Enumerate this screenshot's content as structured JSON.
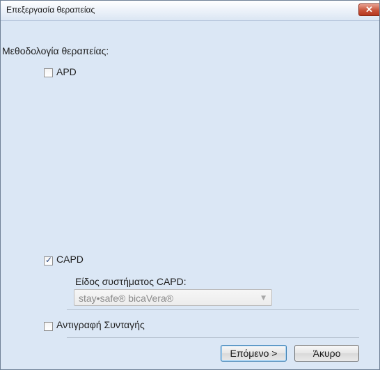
{
  "window": {
    "title": "Επεξεργασία θεραπείας",
    "close_icon": "close-icon",
    "close_glyph": "✕"
  },
  "form": {
    "methodology_label": "Μεθοδολογία θεραπείας:",
    "apd": {
      "label": "APD",
      "checked": false
    },
    "capd": {
      "label": "CAPD",
      "checked": true
    },
    "system_type_label": "Είδος συστήματος CAPD:",
    "system_type_value": "stay•safe® bicaVera®",
    "system_type_enabled": false,
    "copy_prescription": {
      "label": "Αντιγραφή Συνταγής",
      "checked": false
    }
  },
  "buttons": {
    "next": "Επόμενο >",
    "cancel": "Άκυρο"
  },
  "colors": {
    "dialog_background": "#dbe7f5",
    "close_button": "#c8533a"
  }
}
